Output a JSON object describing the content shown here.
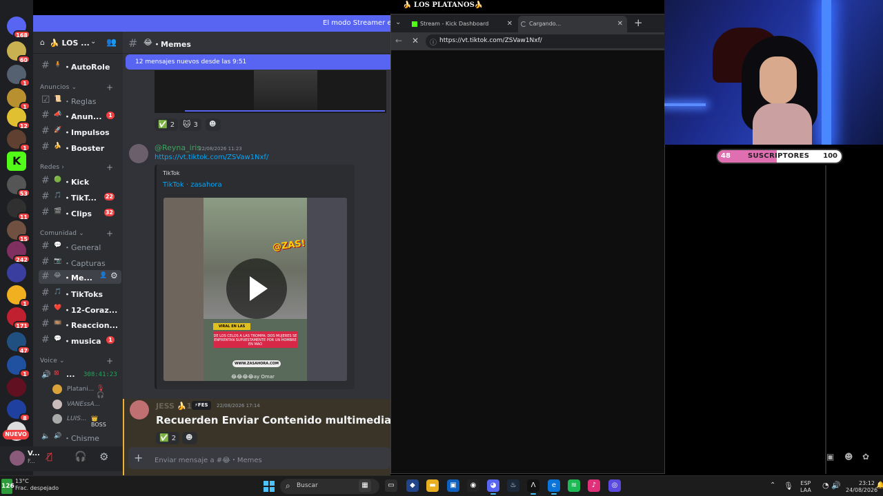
{
  "discord": {
    "app_title": "🍌 LOS PLATANOS🍌",
    "streamer_banner": "El modo Streamer está",
    "server_name": "LOS ...",
    "server_icon": "🍌",
    "rail": {
      "dm_count": "168",
      "servers": [
        {
          "badge": "60",
          "color": "#c9b050"
        },
        {
          "badge": "1",
          "color": "#556070"
        },
        {
          "badge": "1",
          "color": "#b89030"
        },
        {
          "badge": "12",
          "color": "#e0c030"
        },
        {
          "badge": "1",
          "color": "#604030"
        },
        {
          "badge": "",
          "color": "#53fc18"
        },
        {
          "badge": "53",
          "color": "#555555"
        },
        {
          "badge": "11",
          "color": "#303030"
        },
        {
          "badge": "15",
          "color": "#705040"
        },
        {
          "badge": "242",
          "color": "#803060"
        },
        {
          "badge": "",
          "color": "#3a3f9f"
        },
        {
          "badge": "1",
          "color": "#f0b020"
        },
        {
          "badge": "171",
          "color": "#c02030"
        },
        {
          "badge": "47",
          "color": "#205080"
        },
        {
          "badge": "1",
          "color": "#2050a0"
        },
        {
          "badge": "",
          "color": "#601020"
        },
        {
          "badge": "8",
          "color": "#2040a0"
        },
        {
          "badge": "",
          "color": "#dddddd"
        }
      ],
      "new_label": "NUEVO"
    },
    "channels": {
      "autorole": {
        "emoji": "🧍",
        "label": "・AutoRole"
      },
      "cat_anuncios": "Anuncios",
      "reglas": {
        "emoji": "📜",
        "label": "・Reglas"
      },
      "anuncios": {
        "emoji": "📣",
        "label": "・Anun...",
        "count": "1"
      },
      "impulsos": {
        "emoji": "🚀",
        "label": "・Impulsos"
      },
      "booster": {
        "emoji": "🍌",
        "label": "・Booster"
      },
      "cat_redes": "Redes",
      "kick": {
        "emoji": "🟢",
        "label": "・Kick"
      },
      "tiktok": {
        "emoji": "🎵",
        "label": "・TikT...",
        "count": "22"
      },
      "clips": {
        "emoji": "🎬",
        "label": "・Clips",
        "count": "32"
      },
      "cat_comunidad": "Comunidad",
      "general": {
        "emoji": "💬",
        "label": "・General"
      },
      "capturas": {
        "emoji": "📷",
        "label": "・Capturas"
      },
      "memes": {
        "emoji": "😂",
        "label": "・Me..."
      },
      "tiktoks": {
        "emoji": "🎵",
        "label": "・TikToks"
      },
      "corazones": {
        "emoji": "❤️",
        "label": "・12-Coraz..."
      },
      "reacciones": {
        "emoji": "🎞️",
        "label": "・Reaccion..."
      },
      "musica": {
        "emoji": "💬",
        "label": "・musica",
        "count": "1"
      },
      "cat_voice": "Voice",
      "voice_time": "308:41:23",
      "voice_users": [
        "Platani...",
        "VANEssA...",
        "LUIS..."
      ],
      "boss_tag": "BOSS",
      "chisme": {
        "emoji": "🔊",
        "label": "・Chisme"
      }
    },
    "user_panel": {
      "name": "V...",
      "status": "F..."
    },
    "chat": {
      "channel_emoji": "😂",
      "channel_title": "・Memes",
      "new_messages": "12 mensajes nuevos desde las 9:51",
      "reactions_top": [
        {
          "emoji": "✅",
          "count": "2"
        },
        {
          "emoji": "🐱",
          "count": "3"
        }
      ],
      "message1": {
        "author": "@Reyna_iris",
        "timestamp": "22/08/2026 11:23",
        "link": "https://vt.tiktok.com/ZSVaw1Nxf/",
        "embed_provider": "TikTok",
        "embed_title": "TikTok · zasahora",
        "video": {
          "viral_tag": "VIRAL EN LAS REDES",
          "banner_text": "DE LOS CELOS A LAS TROMPA: DOS MUJERES SE ENFRENTAN SUPUESTAMENTE POR UN HOMBRE EN MAO",
          "site": "WWW.ZASAHORA.COM",
          "caption": "😂😂😂😂ay Omar",
          "logo": "@ZAS!"
        }
      },
      "message2": {
        "author": "JESS 🍌1",
        "tag": "⚡FES",
        "timestamp": "22/08/2026 17:14",
        "body": "Recuerden Enviar Contenido multimedia chisme"
      },
      "reactions_bottom": [
        {
          "emoji": "✅",
          "count": "2"
        }
      ],
      "composer_placeholder": "Enviar mensaje a #😂・Memes"
    }
  },
  "browser": {
    "tabs": [
      {
        "title": "Stream - Kick Dashboard"
      },
      {
        "title": "Cargando..."
      }
    ],
    "url": "https://vt.tiktok.com/ZSVaw1Nxf/"
  },
  "stream_overlay": {
    "subs_current": "48",
    "subs_label": "SUSCRIPTORES",
    "subs_goal": "100",
    "subs_progress": 0.48
  },
  "taskbar": {
    "weather_temp": "13°C",
    "weather_desc": "Frac. despejado",
    "weather_badge": "126",
    "search_placeholder": "Buscar",
    "lang_line1": "ESP",
    "lang_line2": "LAA",
    "time": "23:12",
    "date": "24/08/2026"
  },
  "colors": {
    "discord_blurple": "#5865f2",
    "kick_green": "#53fc18",
    "badge_red": "#f23f42",
    "subs_pink": "#e06fb1"
  }
}
